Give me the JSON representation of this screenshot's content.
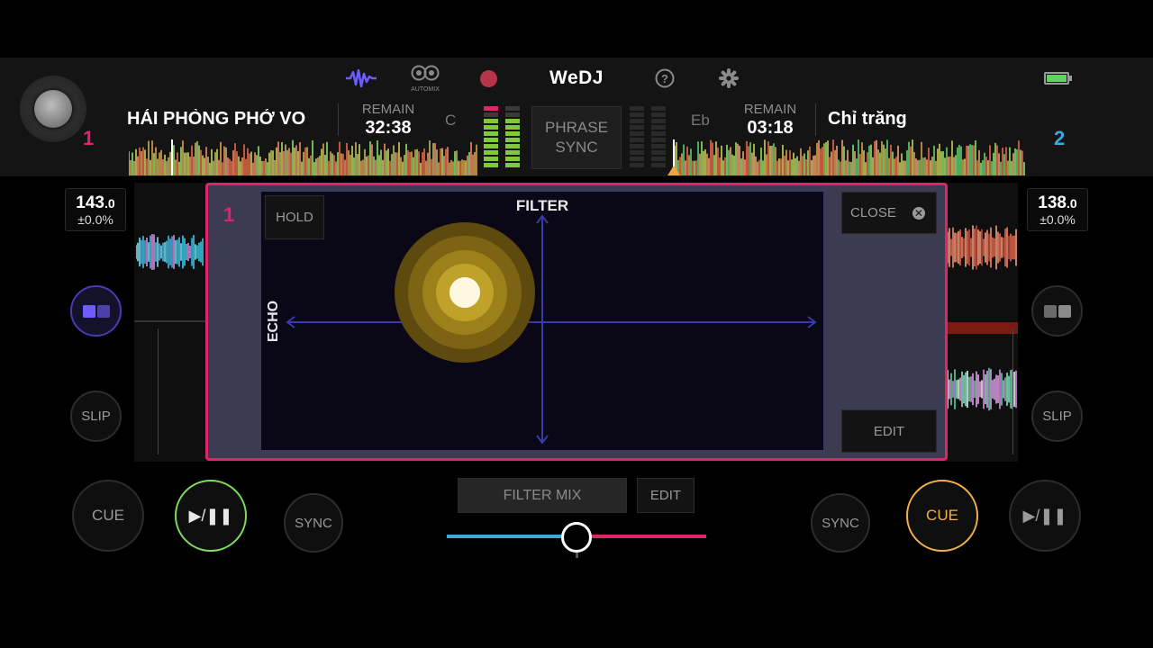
{
  "app": {
    "brand": "WeDJ",
    "automix_label": "AUTOMIX"
  },
  "icons": {
    "waveform": "waveform-icon",
    "automix": "automix-icon",
    "record": "record-icon",
    "help": "help-icon",
    "settings": "gear-icon",
    "battery": "battery-icon"
  },
  "colors": {
    "deck1": "#e0246c",
    "deck2": "#3aa9e0",
    "play": "#7fdc5f",
    "cue_active": "#f2b04a",
    "waveform_icon": "#6e5cff",
    "filter_pad_bg": "#0a0717"
  },
  "deck1": {
    "number": "1",
    "title": "HẢI PHÒNG PHỞ VO",
    "remain_label": "REMAIN",
    "remain_time": "32:38",
    "key": "C",
    "bpm_int": "143",
    "bpm_dec": ".0",
    "pitch": "±0.0%",
    "slip_label": "SLIP",
    "cue_label": "CUE",
    "play_label": "▶/❚❚",
    "sync_label": "SYNC"
  },
  "deck2": {
    "number": "2",
    "title": "Chỉ trăng",
    "remain_label": "REMAIN",
    "remain_time": "03:18",
    "key": "Eb",
    "bpm_int": "138",
    "bpm_dec": ".0",
    "pitch": "±0.0%",
    "slip_label": "SLIP",
    "cue_label": "CUE",
    "play_label": "▶/❚❚",
    "sync_label": "SYNC"
  },
  "phrase_sync": {
    "line1": "PHRASE",
    "line2": "SYNC"
  },
  "fx_panel": {
    "deck_number": "1",
    "hold_label": "HOLD",
    "x_label": "FILTER",
    "y_label": "ECHO",
    "close_label": "CLOSE",
    "edit_label": "EDIT"
  },
  "mixer": {
    "filter_mix_label": "FILTER MIX",
    "edit_label": "EDIT",
    "crossfader_position": 0.5
  }
}
